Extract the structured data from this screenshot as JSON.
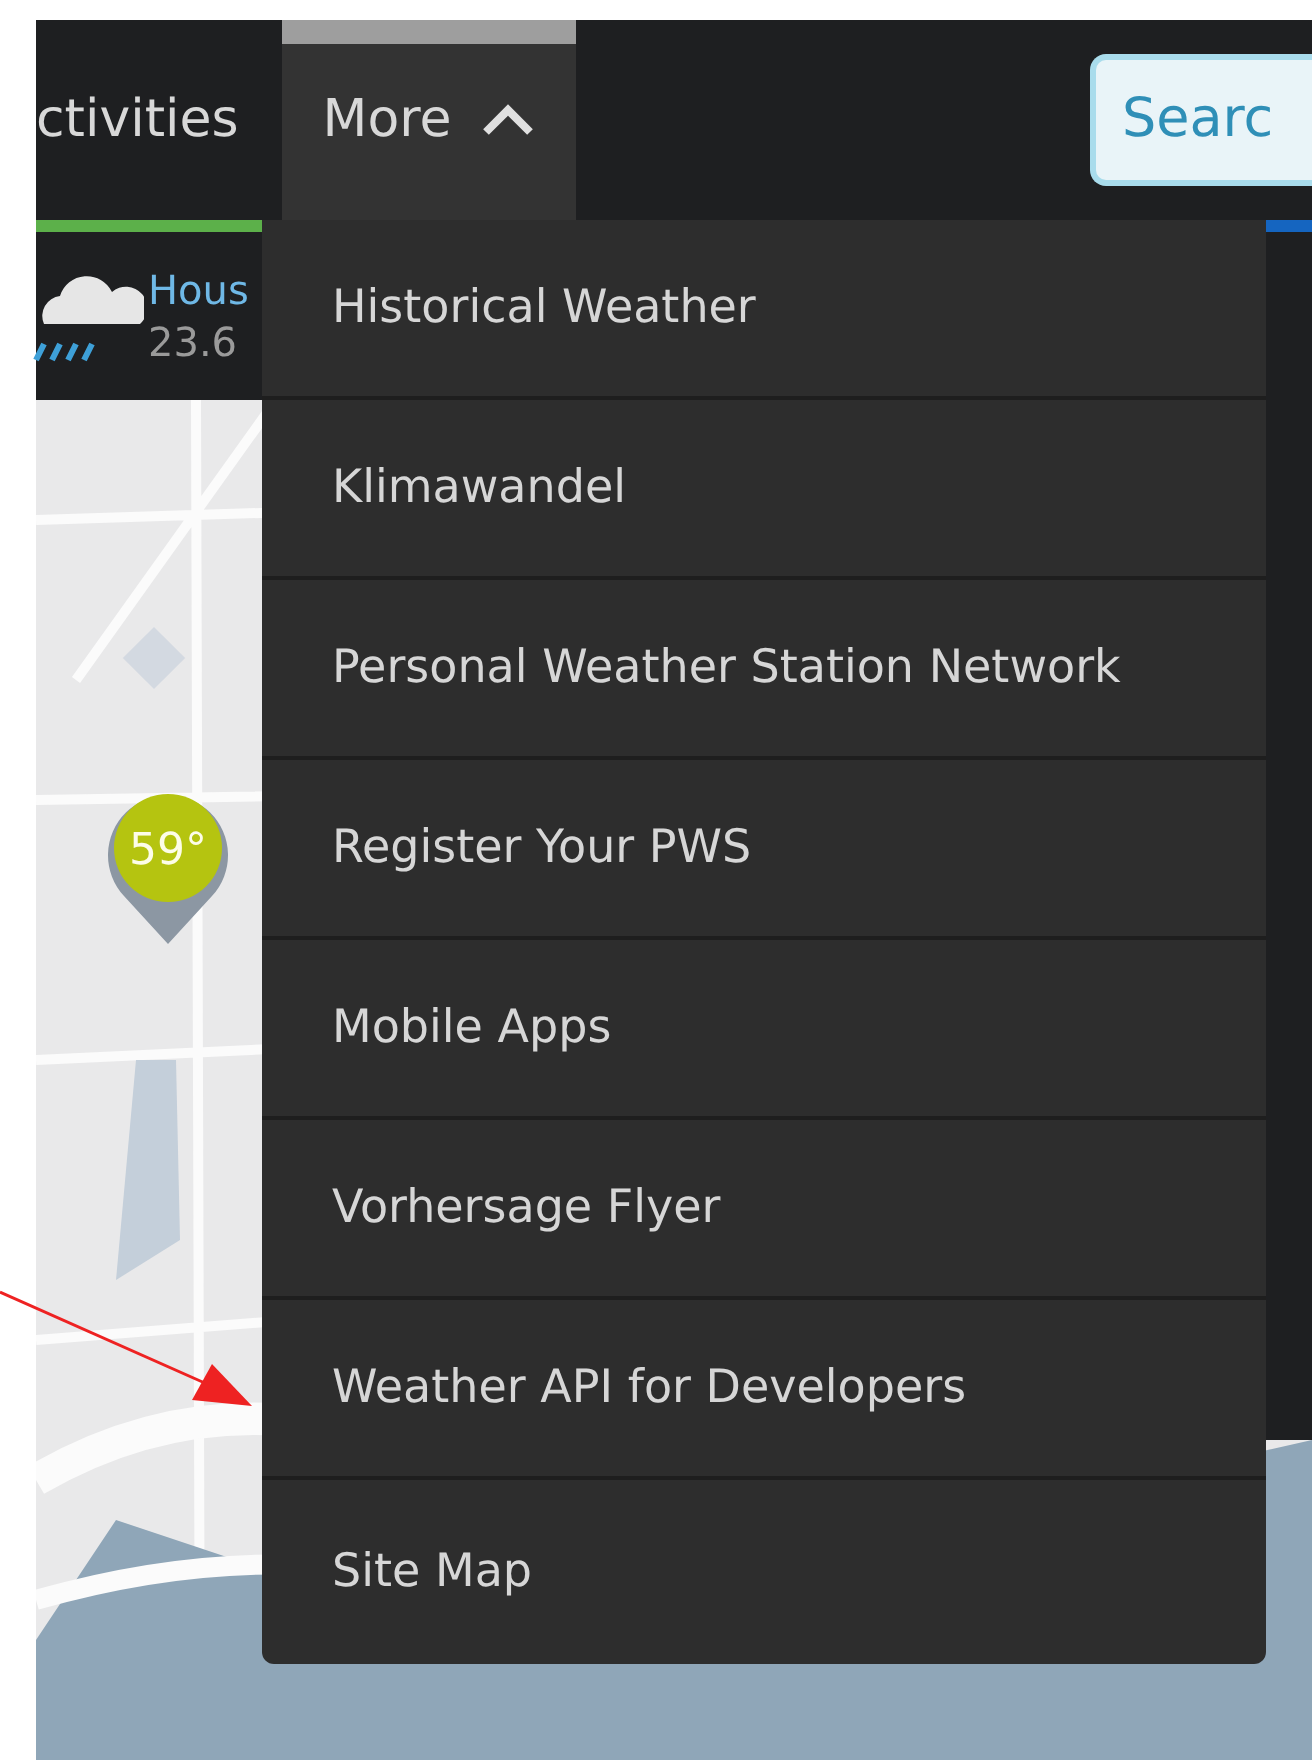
{
  "nav": {
    "items": [
      {
        "label": "ctivities",
        "selected": false,
        "expanded": false
      },
      {
        "label": "More",
        "selected": true,
        "expanded": true
      }
    ],
    "search_button": "Searc"
  },
  "weather": {
    "location": "Hous",
    "temperature": "23.6"
  },
  "map": {
    "marker": "59°"
  },
  "dropdown": {
    "items": [
      {
        "label": "Historical Weather"
      },
      {
        "label": "Klimawandel"
      },
      {
        "label": "Personal Weather Station Network"
      },
      {
        "label": "Register Your PWS"
      },
      {
        "label": "Mobile Apps"
      },
      {
        "label": "Vorhersage Flyer"
      },
      {
        "label": "Weather API for Developers"
      },
      {
        "label": "Site Map"
      }
    ]
  }
}
